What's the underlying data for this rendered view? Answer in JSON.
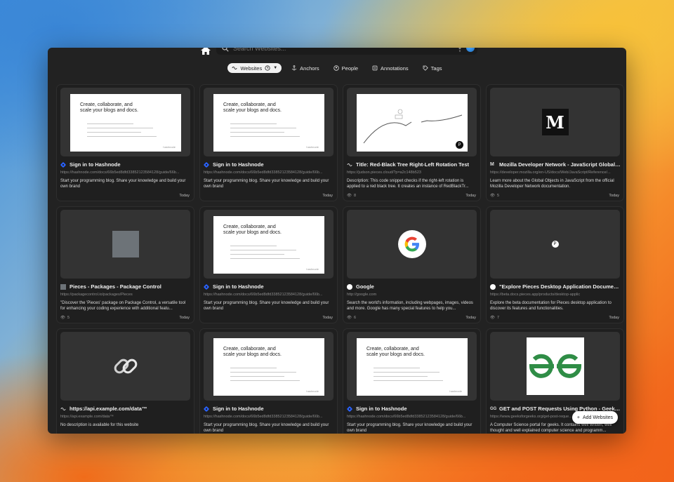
{
  "search": {
    "placeholder": "Search Websites..."
  },
  "filters": [
    {
      "label": "Websites",
      "icon": "link-icon",
      "active": true
    },
    {
      "label": "Anchors",
      "icon": "anchor-icon",
      "active": false
    },
    {
      "label": "People",
      "icon": "person-icon",
      "active": false
    },
    {
      "label": "Annotations",
      "icon": "annotation-icon",
      "active": false
    },
    {
      "label": "Tags",
      "icon": "tag-icon",
      "active": false
    }
  ],
  "thumb_text": {
    "hashnode_headline": "Create, collaborate, and scale your blogs and docs.",
    "hashnode_brand": "hashnode"
  },
  "cards": [
    {
      "title": "Sign in to Hashnode",
      "url": "https://hashnode.com/docs/66b5ed8dfd33852123584128/guide/66b...",
      "desc": "Start your programming blog. Share your knowledge and build your own brand",
      "views": "",
      "date": "Today",
      "thumb": "hashnode",
      "favicon": "hashnode-icon"
    },
    {
      "title": "Sign in to Hashnode",
      "url": "https://hashnode.com/docs/66b5ed8dfd33852123584128/guide/66b...",
      "desc": "Start your programming blog. Share your knowledge and build your own brand",
      "views": "",
      "date": "Today",
      "thumb": "hashnode",
      "favicon": "hashnode-icon"
    },
    {
      "title": "Title: Red-Black Tree Right-Left Rotation Test",
      "url": "https://judson.pieces.cloud/?p=a2c148b523",
      "desc": "Description: This code snippet checks if the right-left rotation is applied to a red black tree. It creates an instance of RedBlackTr...",
      "views": "8",
      "date": "Today",
      "thumb": "rbt",
      "favicon": "link-icon"
    },
    {
      "title": "Mozilla Developer Network - JavaScript Global Obj...",
      "url": "https://developer.mozilla.org/en-US/docs/Web/JavaScript/Reference/...",
      "desc": "Learn more about the Global Objects in JavaScript from the official Mozilla Developer Network documentation.",
      "views": "5",
      "date": "Today",
      "thumb": "mdn",
      "favicon": "mdn-icon"
    },
    {
      "title": "Pieces - Packages - Package Control",
      "url": "https://packagecontrol.io/packages/Pieces",
      "desc": "\"Discover the 'Pieces' package on Package Control, a versatile tool for enhancing your coding experience with additional featu...",
      "views": "5",
      "date": "Today",
      "thumb": "pkg",
      "favicon": "package-icon"
    },
    {
      "title": "Sign in to Hashnode",
      "url": "https://hashnode.com/docs/66b5ed8dfd33852123584128/guide/66b...",
      "desc": "Start your programming blog. Share your knowledge and build your own brand",
      "views": "",
      "date": "Today",
      "thumb": "hashnode",
      "favicon": "hashnode-icon"
    },
    {
      "title": "Google",
      "url": "http://google.com",
      "desc": "Search the world's information, including webpages, images, videos and more. Google has many special features to help you...",
      "views": "6",
      "date": "Today",
      "thumb": "google",
      "favicon": "google-icon"
    },
    {
      "title": "\"Explore Pieces Desktop Application Documentatio...",
      "url": "https://beta.docs.pieces.app/products/desktop-applic",
      "desc": "Explore the beta documentation for Pieces desktop application to discover its features and functionalities.",
      "views": "7",
      "date": "Today",
      "thumb": "pieces",
      "favicon": "pieces-icon"
    },
    {
      "title": "https://api.example.com/data™",
      "url": "https://api.example.com/data™",
      "desc": "No description is available for this website",
      "views": "",
      "date": "",
      "thumb": "chain",
      "favicon": "link-icon"
    },
    {
      "title": "Sign in to Hashnode",
      "url": "https://hashnode.com/docs/66b5ed8dfd33852123584128/guide/66b...",
      "desc": "Start your programming blog. Share your knowledge and build your own brand",
      "views": "",
      "date": "",
      "thumb": "hashnode",
      "favicon": "hashnode-icon"
    },
    {
      "title": "Sign in to Hashnode",
      "url": "https://hashnode.com/docs/66b5ed8dfd33852123584128/guide/66b...",
      "desc": "Start your programming blog. Share your knowledge and build your own brand",
      "views": "",
      "date": "",
      "thumb": "hashnode",
      "favicon": "hashnode-icon"
    },
    {
      "title": "GET and POST Requests Using Python - Geeksfor...",
      "url": "https://www.geeksforgeeks.org/get-post-reque...",
      "desc": "A Computer Science portal for geeks. It contains well written, well thought and well explained computer science and programm...",
      "views": "",
      "date": "",
      "thumb": "gfg",
      "favicon": "gfg-icon"
    }
  ],
  "add_button": {
    "label": "Add Websites"
  },
  "colors": {
    "window_bg": "#222222",
    "card_bg": "#1f1f1f",
    "hashnode_blue": "#2962ff"
  }
}
